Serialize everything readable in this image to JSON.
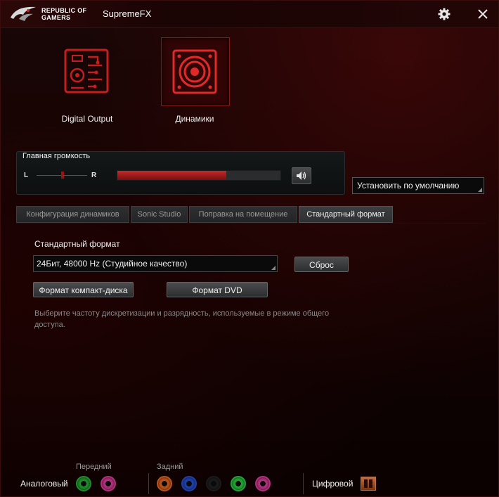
{
  "window": {
    "brand_line1": "REPUBLIC OF",
    "brand_line2": "GAMERS",
    "title": "SupremeFX",
    "icons": [
      "settings-gear-icon",
      "close-icon"
    ]
  },
  "devices": [
    {
      "label": "Digital Output",
      "icon": "digital-output-icon",
      "selected": false
    },
    {
      "label": "Динамики",
      "icon": "speaker-icon",
      "selected": true
    }
  ],
  "volume": {
    "title": "Главная громкость",
    "left_label": "L",
    "right_label": "R",
    "level_percent": 67,
    "balance_percent": 50,
    "mute_icon": "speaker-volume-icon"
  },
  "default_button": "Установить по умолчанию",
  "tabs": [
    {
      "label": "Конфигурация динамиков",
      "active": false
    },
    {
      "label": "Sonic Studio",
      "active": false
    },
    {
      "label": "Поправка на помещение",
      "active": false
    },
    {
      "label": "Стандартный формат",
      "active": true
    }
  ],
  "format": {
    "title": "Стандартный формат",
    "selected": "24Бит, 48000 Hz (Студийное качество)",
    "reset_button": "Сброс",
    "cd_button": "Формат компакт-диска",
    "dvd_button": "Формат DVD",
    "hint": "Выберите частоту дискретизации и разрядность, используемые в режиме общего доступа."
  },
  "jacks": {
    "analog_label": "Аналоговый",
    "front_label": "Передний",
    "rear_label": "Задний",
    "digital_label": "Цифровой",
    "front": [
      {
        "name": "front-green-jack",
        "color": "#1e8a2a"
      },
      {
        "name": "front-pink-jack",
        "color": "#b0307a"
      }
    ],
    "rear": [
      {
        "name": "rear-orange-jack",
        "color": "#b8521c"
      },
      {
        "name": "rear-blue-jack",
        "color": "#1f3fa8"
      },
      {
        "name": "rear-black-jack",
        "color": "#1a1a1a"
      },
      {
        "name": "rear-green-jack",
        "color": "#22a234"
      },
      {
        "name": "rear-pink-jack",
        "color": "#b0307a"
      }
    ],
    "digital_icon": "spdif-port-icon"
  },
  "colors": {
    "accent": "#c42a2a",
    "background": "#120303"
  }
}
